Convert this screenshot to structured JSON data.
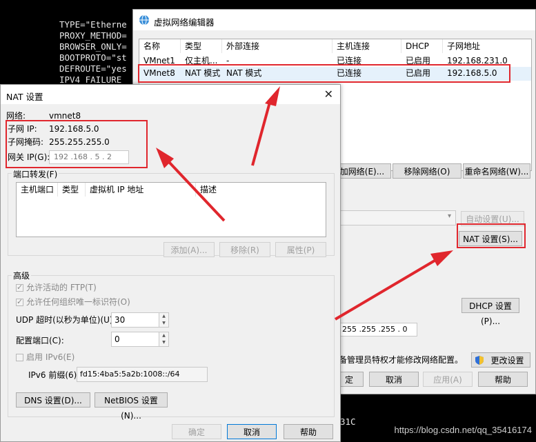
{
  "terminal": {
    "lines": [
      "TYPE=\"Etherne",
      "PROXY_METHOD=",
      "BROWSER_ONLY=",
      "BOOTPROTO=\"st",
      "DEFROUTE=\"yes",
      "IPV4_FAILURE_"
    ],
    "bottom_text": "31C",
    "watermark": "https://blog.csdn.net/qq_35416174"
  },
  "vne": {
    "title": "虚拟网络编辑器",
    "columns": [
      "名称",
      "类型",
      "外部连接",
      "主机连接",
      "DHCP",
      "子网地址"
    ],
    "rows": [
      {
        "name": "VMnet1",
        "type": "仅主机...",
        "ext": "-",
        "host": "已连接",
        "dhcp": "已启用",
        "subnet": "192.168.231.0"
      },
      {
        "name": "VMnet8",
        "type": "NAT 模式",
        "ext": "NAT 模式",
        "host": "已连接",
        "dhcp": "已启用",
        "subnet": "192.168.5.0"
      }
    ],
    "add_network": "加网络(E)...",
    "remove_network": "移除网络(O)",
    "rename_network": "重命名网络(W)...",
    "auto_settings": "自动设置(U)...",
    "nat_settings": "NAT 设置(S)...",
    "dhcp_settings": "DHCP 设置(P)...",
    "subnet_mask_value": "255 .255 .255 . 0",
    "admin_notice": "备管理员特权才能修改网络配置。",
    "change_settings": "更改设置(C)",
    "ok": "定",
    "cancel": "取消",
    "apply": "应用(A)",
    "help": "帮助"
  },
  "nat": {
    "title": "NAT 设置",
    "network_label": "网络:",
    "network_value": "vmnet8",
    "subnet_ip_label": "子网 IP:",
    "subnet_ip_value": "192.168.5.0",
    "mask_label": "子网掩码:",
    "mask_value": "255.255.255.0",
    "gateway_label": "网关 IP(G):",
    "gateway_value": "192 .168 . 5 . 2",
    "port_forward_label": "端口转发(F)",
    "pf_columns": [
      "主机端口",
      "类型",
      "虚拟机 IP 地址",
      "描述"
    ],
    "pf_add": "添加(A)...",
    "pf_remove": "移除(R)",
    "pf_props": "属性(P)",
    "advanced_label": "高级",
    "allow_ftp": "允许活动的 FTP(T)",
    "allow_oui": "允许任何组织唯一标识符(O)",
    "udp_label": "UDP 超时(以秒为单位)(U):",
    "udp_value": "30",
    "config_port_label": "配置端口(C):",
    "config_port_value": "0",
    "enable_ipv6": "启用 IPv6(E)",
    "ipv6_prefix_label": "IPv6 前缀(6):",
    "ipv6_prefix_value": "fd15:4ba5:5a2b:1008::/64",
    "dns_btn": "DNS 设置(D)...",
    "netbios_btn": "NetBIOS 设置(N)...",
    "ok": "确定",
    "cancel": "取消",
    "help": "帮助"
  },
  "colors": {
    "highlight": "#e0262d",
    "arrow": "#e0262d"
  }
}
